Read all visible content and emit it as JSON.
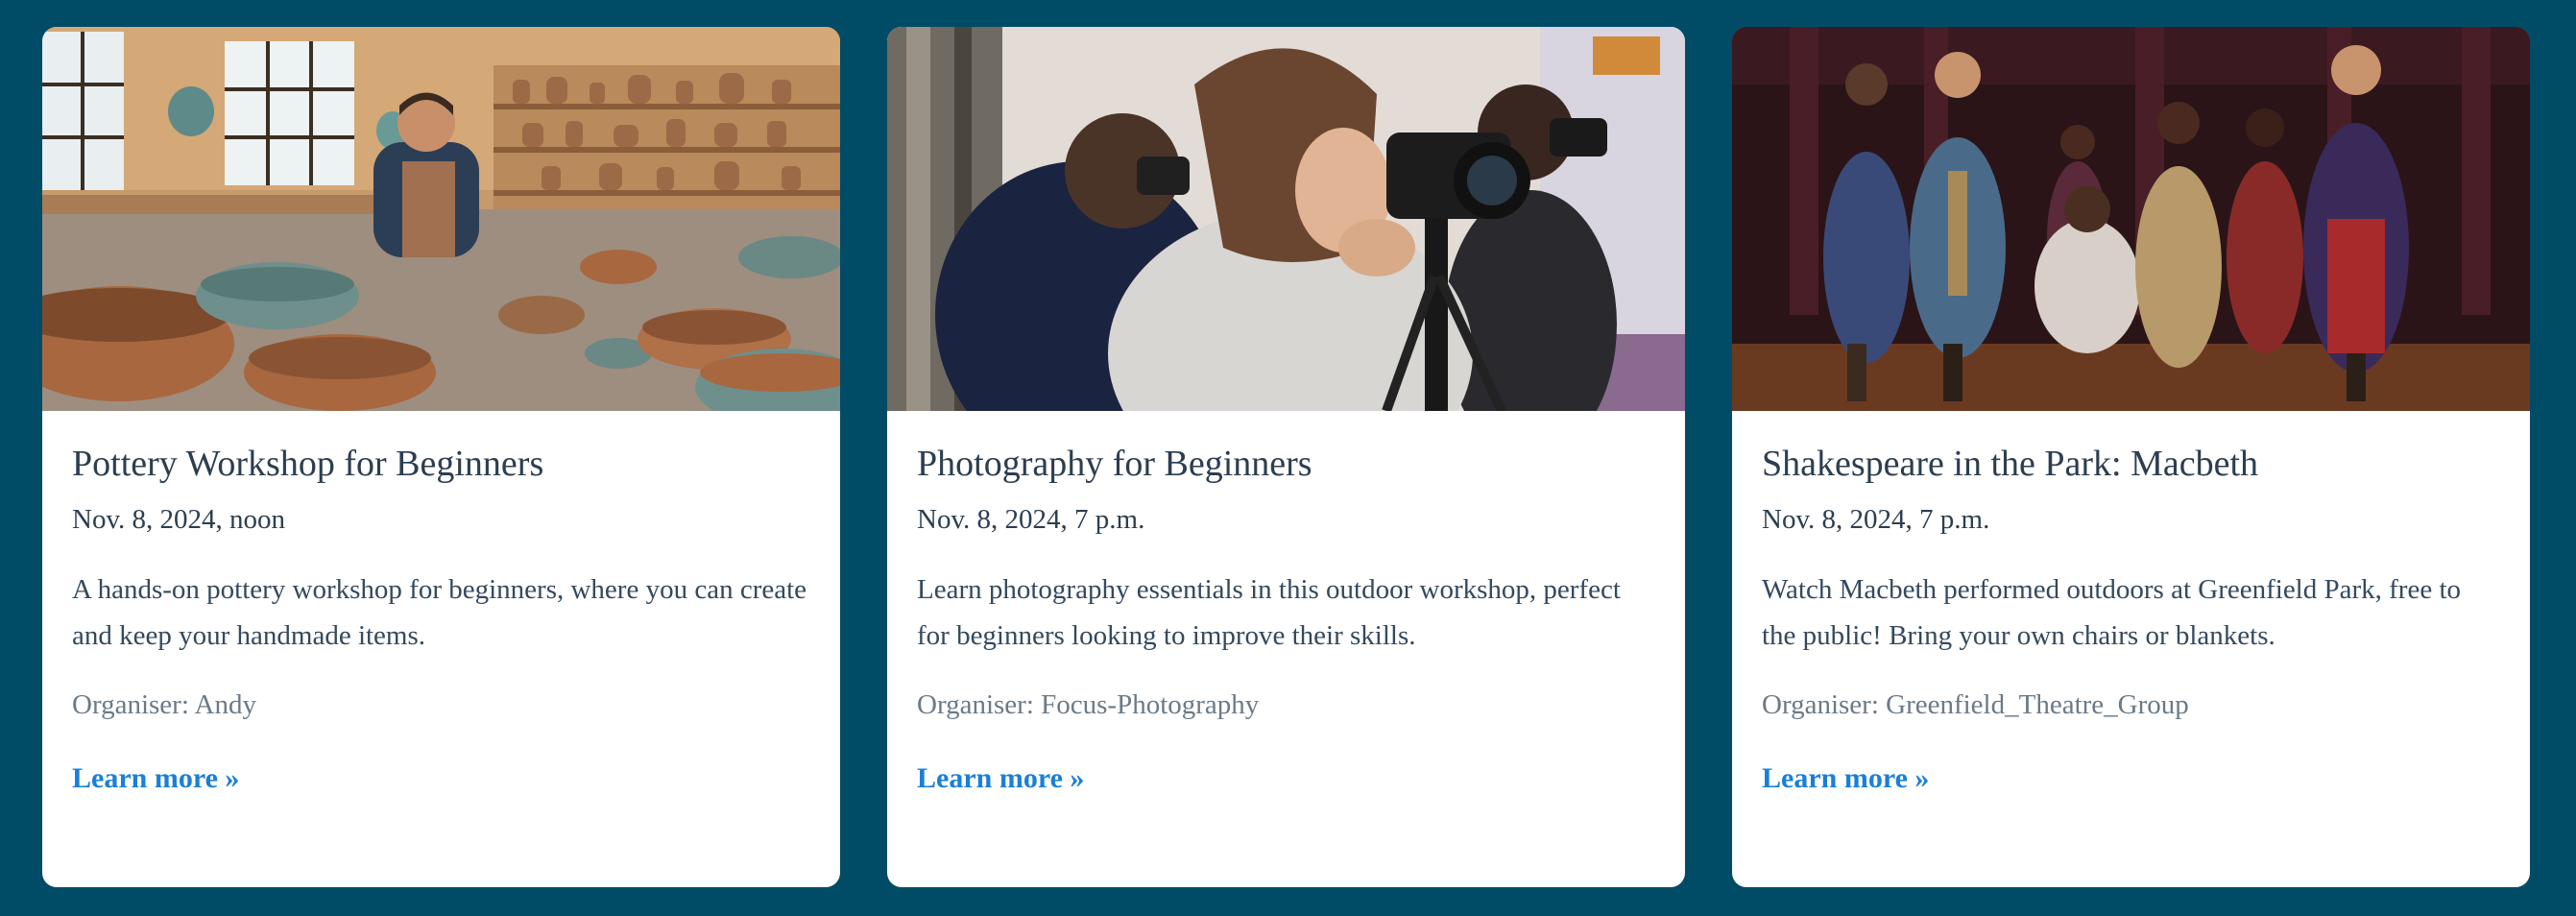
{
  "colors": {
    "page_background": "#004b66",
    "card_background": "#ffffff",
    "title_text": "#2c3e50",
    "organiser_text": "#6b7a87",
    "link": "#1a7fd8"
  },
  "events": [
    {
      "image_alt": "Smiling potter in apron in a studio full of clay bowls and shelves of pottery",
      "title": "Pottery Workshop for Beginners",
      "date": "Nov. 8, 2024, noon",
      "description": "A hands-on pottery workshop for beginners, where you can create and keep your handmade items.",
      "organiser": "Organiser: Andy",
      "link_label": "Learn more »"
    },
    {
      "image_alt": "People looking through cameras on tripods during a photography workshop",
      "title": "Photography for Beginners",
      "date": "Nov. 8, 2024, 7 p.m.",
      "description": "Learn photography essentials in this outdoor workshop, perfect for beginners looking to improve their skills.",
      "organiser": "Organiser: Focus-Photography",
      "link_label": "Learn more »"
    },
    {
      "image_alt": "Costumed actors performing Macbeth on a dimly lit stage",
      "title": "Shakespeare in the Park: Macbeth",
      "date": "Nov. 8, 2024, 7 p.m.",
      "description": "Watch Macbeth performed outdoors at Greenfield Park, free to the public! Bring your own chairs or blankets.",
      "organiser": "Organiser: Greenfield_Theatre_Group",
      "link_label": "Learn more »"
    }
  ]
}
